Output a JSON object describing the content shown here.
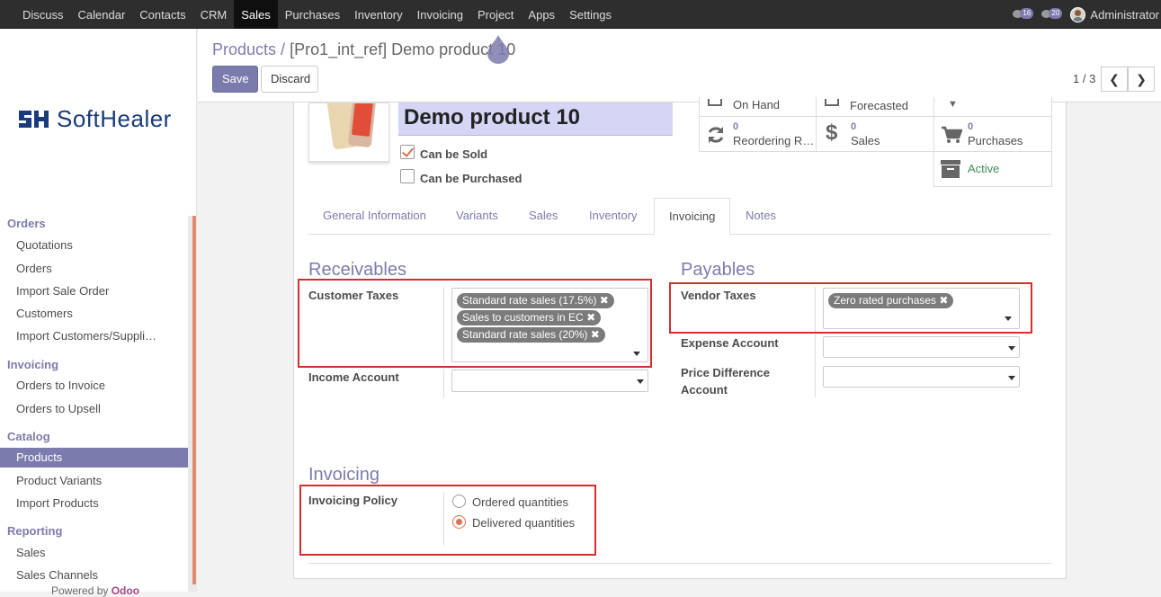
{
  "nav": {
    "menu": [
      "Discuss",
      "Calendar",
      "Contacts",
      "CRM",
      "Sales",
      "Purchases",
      "Inventory",
      "Invoicing",
      "Project",
      "Apps",
      "Settings"
    ],
    "active_menu": "Sales",
    "activity_count": "16",
    "message_count": "20",
    "user": "Administrator"
  },
  "logo": {
    "text": "SoftHealer"
  },
  "sidebar": {
    "sections": [
      {
        "title": "Orders",
        "items": [
          "Quotations",
          "Orders",
          "Import Sale Order",
          "Customers",
          "Import Customers/Suppli…"
        ]
      },
      {
        "title": "Invoicing",
        "items": [
          "Orders to Invoice",
          "Orders to Upsell"
        ]
      },
      {
        "title": "Catalog",
        "items": [
          "Products",
          "Product Variants",
          "Import Products"
        ]
      },
      {
        "title": "Reporting",
        "items": [
          "Sales",
          "Sales Channels"
        ]
      }
    ],
    "active_item": "Products",
    "powered_by": "Powered by",
    "powered_brand": "Odoo"
  },
  "control": {
    "breadcrumb_parent": "Products",
    "breadcrumb_sep": " / ",
    "breadcrumb_current": "[Pro1_int_ref] Demo product 10",
    "save_label": "Save",
    "discard_label": "Discard",
    "pager": "1 / 3"
  },
  "product": {
    "name": "Demo product 10",
    "can_be_sold_label": "Can be Sold",
    "can_be_sold": true,
    "can_be_purchased_label": "Can be Purchased",
    "can_be_purchased": false
  },
  "smart_buttons": {
    "on_hand": "On Hand",
    "forecasted": "Forecasted",
    "reordering_count": "0",
    "reordering_label": "Reordering R…",
    "sales_count": "0",
    "sales_label": "Sales",
    "purchases_count": "0",
    "purchases_label": "Purchases",
    "active_label": "Active"
  },
  "tabs": [
    "General Information",
    "Variants",
    "Sales",
    "Inventory",
    "Invoicing",
    "Notes"
  ],
  "active_tab": "Invoicing",
  "receivables": {
    "title": "Receivables",
    "customer_taxes_label": "Customer Taxes",
    "customer_taxes": [
      "Standard rate sales (17.5%)",
      "Sales to customers in EC",
      "Standard rate sales (20%)"
    ],
    "income_account_label": "Income Account"
  },
  "payables": {
    "title": "Payables",
    "vendor_taxes_label": "Vendor Taxes",
    "vendor_taxes": [
      "Zero rated purchases"
    ],
    "expense_account_label": "Expense Account",
    "price_difference_label": "Price Difference Account"
  },
  "invoicing": {
    "title": "Invoicing",
    "policy_label": "Invoicing Policy",
    "options": [
      "Ordered quantities",
      "Delivered quantities"
    ],
    "selected": "Delivered quantities"
  },
  "colors": {
    "accent": "#7c7bad",
    "highlight_box": "#d32f2f",
    "radio_checked": "#e07050"
  }
}
